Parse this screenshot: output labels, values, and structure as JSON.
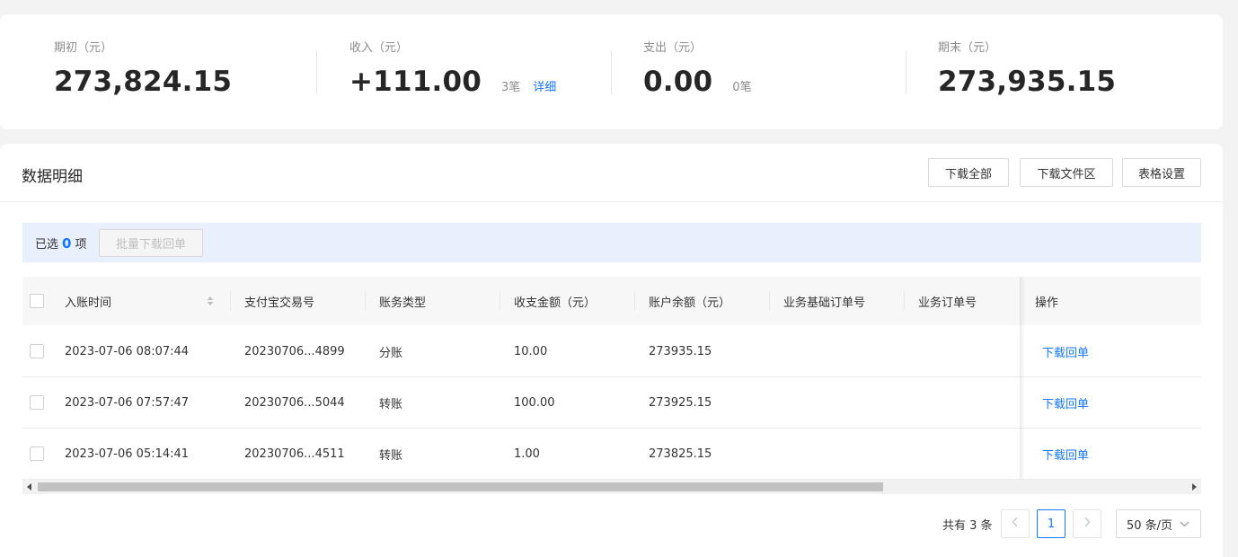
{
  "summary": {
    "opening": {
      "label": "期初（元）",
      "value": "273,824.15"
    },
    "income": {
      "label": "收入（元）",
      "value": "+111.00",
      "count": "3笔",
      "detail_link": "详细"
    },
    "expense": {
      "label": "支出（元）",
      "value": "0.00",
      "count": "0笔"
    },
    "closing": {
      "label": "期末（元）",
      "value": "273,935.15"
    }
  },
  "panel": {
    "title": "数据明细",
    "buttons": {
      "download_all": "下载全部",
      "download_files": "下载文件区",
      "table_settings": "表格设置"
    }
  },
  "selection": {
    "prefix": "已选",
    "count": "0",
    "suffix": "项",
    "batch_button": "批量下载回单"
  },
  "table": {
    "columns": [
      "入账时间",
      "支付宝交易号",
      "账务类型",
      "收支金额（元）",
      "账户余额（元）",
      "业务基础订单号",
      "业务订单号",
      "操作"
    ],
    "rows": [
      {
        "time": "2023-07-06 08:07:44",
        "trade_no": "20230706...4899",
        "type": "分账",
        "amount": "10.00",
        "balance": "273935.15",
        "action": "下载回单"
      },
      {
        "time": "2023-07-06 07:57:47",
        "trade_no": "20230706...5044",
        "type": "转账",
        "amount": "100.00",
        "balance": "273925.15",
        "action": "下载回单"
      },
      {
        "time": "2023-07-06 05:14:41",
        "trade_no": "20230706...4511",
        "type": "转账",
        "amount": "1.00",
        "balance": "273825.15",
        "action": "下载回单"
      }
    ]
  },
  "pagination": {
    "total": "共有 3 条",
    "current_page": "1",
    "page_size": "50 条/页"
  },
  "icons": {
    "sort": "sort-icon",
    "prev": "chevron-left-icon",
    "next": "chevron-right-icon",
    "dropdown": "chevron-down-icon"
  },
  "colors": {
    "accent": "#1677ff",
    "selection_bg": "#e8f0fd"
  }
}
